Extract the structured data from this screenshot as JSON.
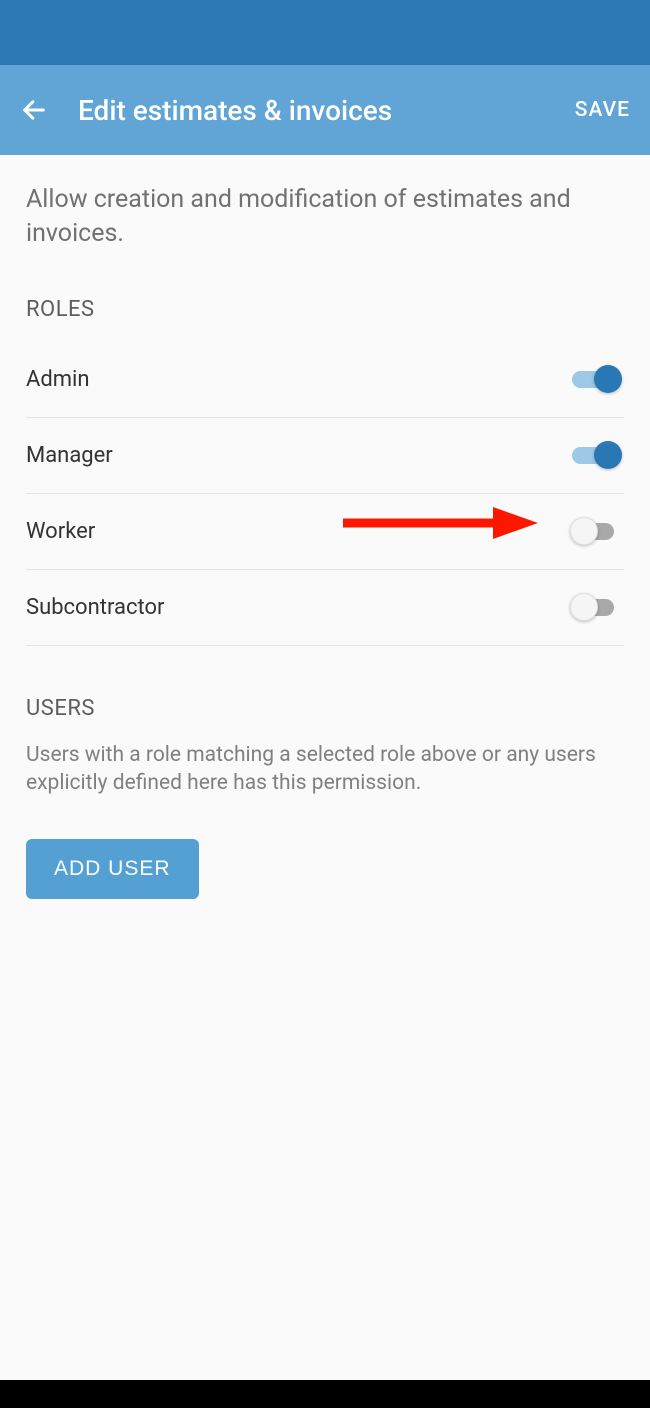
{
  "header": {
    "title": "Edit estimates & invoices",
    "save_label": "SAVE"
  },
  "description": "Allow creation and modification of estimates and invoices.",
  "roles_section": {
    "header": "ROLES",
    "items": [
      {
        "label": "Admin",
        "enabled": true
      },
      {
        "label": "Manager",
        "enabled": true
      },
      {
        "label": "Worker",
        "enabled": false
      },
      {
        "label": "Subcontractor",
        "enabled": false
      }
    ]
  },
  "users_section": {
    "header": "USERS",
    "description": "Users with a role matching a selected role above or any users explicitly defined here has this permission.",
    "add_button_label": "ADD USER"
  },
  "colors": {
    "status_bar": "#2c78b3",
    "app_bar": "#60a5d6",
    "accent": "#2a77b5",
    "button": "#54a0d3",
    "annotation_arrow": "#fc1700"
  }
}
